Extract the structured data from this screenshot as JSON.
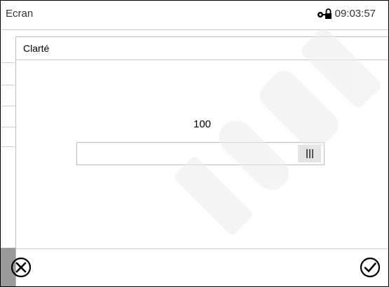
{
  "screen": {
    "title": "Ecran",
    "time": "09:03:57",
    "status_icon": "lock-key-icon"
  },
  "dialog": {
    "title": "Clarté",
    "value": "100",
    "slider_level_percent": 100,
    "cancel_icon": "cancel-circle-icon",
    "confirm_icon": "confirm-check-icon"
  },
  "colors": {
    "frame": "#000000",
    "divider": "#c8c8c8",
    "slider_thumb": "#e3e3e3",
    "bottom_strip": "#9a9a9a"
  }
}
